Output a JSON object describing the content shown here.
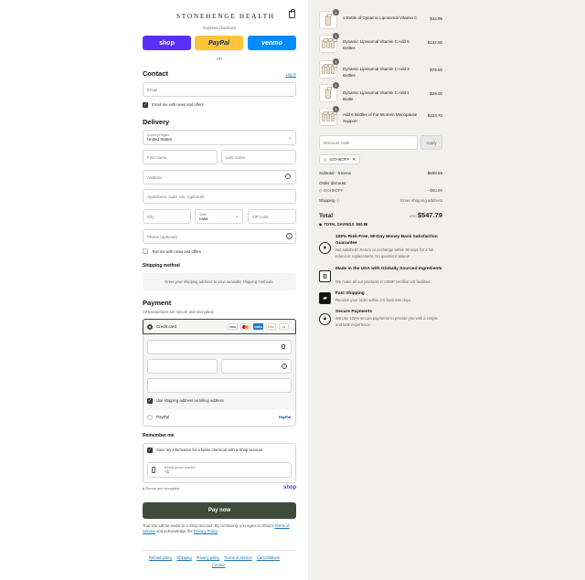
{
  "brand": "STONEHENGE HEALTH",
  "express": {
    "label": "Express checkout",
    "shop": "shop",
    "paypal": "PayPal",
    "venmo": "venmo",
    "or": "OR"
  },
  "contact": {
    "title": "Contact",
    "login": "Log in",
    "email_placeholder": "Email",
    "news_label": "Email me with news and offers"
  },
  "delivery": {
    "title": "Delivery",
    "country_label": "Country/Region",
    "country_value": "United States",
    "first_name": "First name",
    "last_name": "Last name",
    "address": "Address",
    "apartment": "Apartment, suite, etc. (optional)",
    "city": "City",
    "state_label": "State",
    "state_value": "Iowa",
    "zip": "ZIP code",
    "phone": "Phone (optional)",
    "text_label": "Text me with news and offers"
  },
  "shipping_method": {
    "title": "Shipping method",
    "message": "Enter your shipping address to view available shipping methods."
  },
  "payment": {
    "title": "Payment",
    "subtitle": "All transactions are secure and encrypted.",
    "credit_card": "Credit card",
    "brands": [
      "VISA",
      "MC",
      "AMEX",
      "DISC",
      "+5"
    ],
    "billing_label": "Use shipping address as billing address",
    "paypal_label": "PayPal",
    "paypal_logo": "PayPal"
  },
  "remember": {
    "title": "Remember me",
    "save_label": "Save my information for a faster checkout with a Shop account",
    "mobile_label": "Mobile phone number",
    "mobile_value": "+1",
    "secure_label": "Secure and encrypted",
    "shop_logo": "shop"
  },
  "pay_now": "Pay now",
  "legal": {
    "text_before": "Your info will be saved to a Shop account. By continuing, you agree to Shop's ",
    "terms": "Terms of Service",
    "text_mid": " and acknowledge the ",
    "privacy": "Privacy Policy",
    "text_end": "."
  },
  "footer": {
    "links": [
      "Refund policy",
      "Shipping",
      "Privacy policy",
      "Terms of service",
      "Cancellations"
    ],
    "contact": "Contact"
  },
  "order": {
    "items": [
      {
        "qty": "1",
        "name": "1 Bottle of Dynamic Liposomal Vitamin C",
        "price": "$44.95",
        "icon": "single-bottle"
      },
      {
        "qty": "1",
        "name": "Dynamic Liposomal Vitamin C Add 6 Bottles",
        "price": "$132.00",
        "icon": "bottle-bundle"
      },
      {
        "qty": "1",
        "name": "Dynamic Liposomal Vitamin C Add 3 Bottles",
        "price": "$79.00",
        "icon": "bottle-bundle"
      },
      {
        "qty": "1",
        "name": "Dynamic Liposomal Vitamin C Add 1 Bottle",
        "price": "$29.00",
        "icon": "single-bottle"
      },
      {
        "qty": "1",
        "name": "Add 6 Bottles of For Women Menopause Support",
        "price": "$323.70",
        "icon": "bottle-bundle"
      }
    ],
    "discount_placeholder": "Discount code",
    "apply": "Apply",
    "applied_code": "GOH6OFF",
    "subtotal_label": "Subtotal · 5 items",
    "subtotal_value": "$608.65",
    "order_discount_label": "Order discount",
    "order_discount_code": "GOH6OFF",
    "order_discount_value": "−$60.86",
    "shipping_label": "Shipping",
    "shipping_value": "Enter shipping address",
    "total_label": "Total",
    "currency": "USD",
    "total_value": "$547.79",
    "savings_label": "TOTAL SAVINGS",
    "savings_value": "$60.86"
  },
  "guarantees": [
    {
      "icon": "medal-icon",
      "title": "100% Risk-Free, 90-Day Money Back Satisfaction Guarantee",
      "text": "Not satisfied? Return or exchange within 90 days for a full refund or replacement. No questions asked!"
    },
    {
      "icon": "factory-icon",
      "title": "Made in the USA with Globally Sourced Ingredients",
      "text": "We make all our products in cGMP certified US facilities."
    },
    {
      "icon": "truck-icon",
      "title": "Fast Shipping",
      "text": "Receive your order within 3-5 business days."
    },
    {
      "icon": "lock-icon",
      "title": "Secure Payments",
      "text": "We use 100% secure payments to provide you with a simple and safe experience."
    }
  ]
}
